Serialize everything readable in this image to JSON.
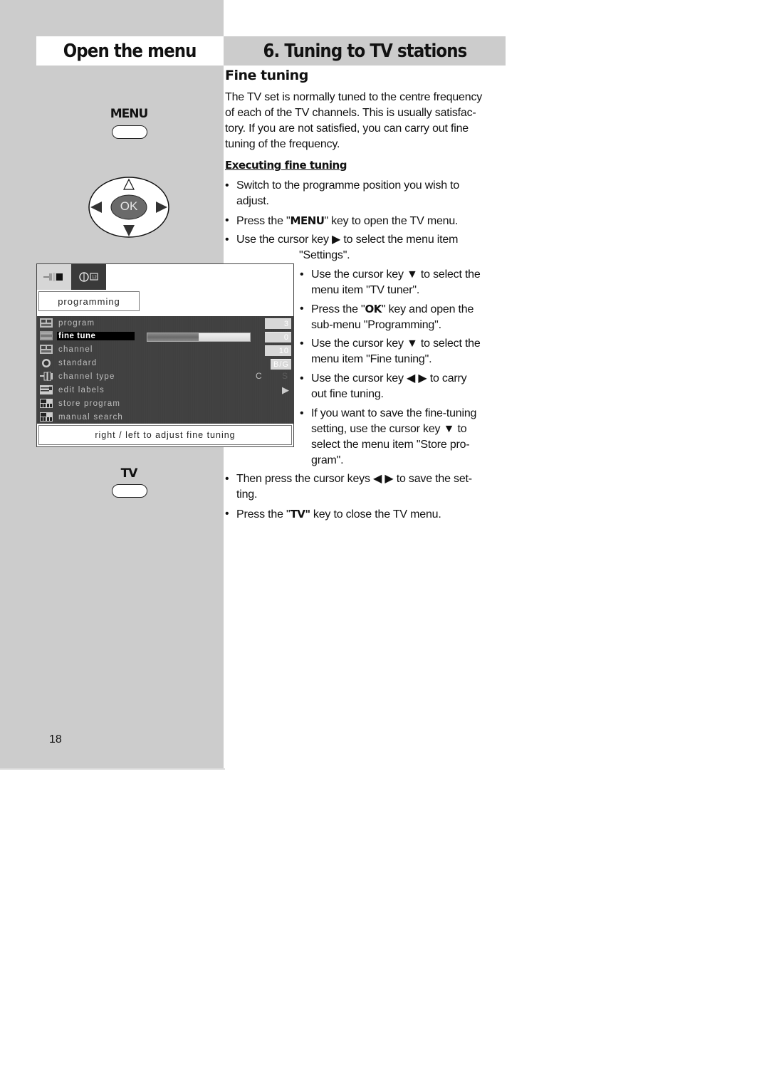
{
  "header": {
    "left_title": "Open the menu",
    "right_title": "6. Tuning to TV stations"
  },
  "remote": {
    "menu_key_label": "MENU",
    "ok_label": "OK",
    "tv_key_label": "TV",
    "dpad_icons": [
      "arrow-up-outline",
      "arrow-left-filled",
      "arrow-right-filled",
      "arrow-down-filled"
    ]
  },
  "osd_menu": {
    "tabs": [
      {
        "icon": "connector-icon",
        "active": true
      },
      {
        "icon": "tuner-dial-icon",
        "active": false
      }
    ],
    "title": "programming",
    "items": [
      {
        "label": "program",
        "icon": "program-grid-icon",
        "value": "3"
      },
      {
        "label": "fine tune",
        "icon": "fine-tune-icon",
        "value": "0",
        "selected": true,
        "slider_fraction": 0.5
      },
      {
        "label": "channel",
        "icon": "program-grid-icon",
        "value": "10"
      },
      {
        "label": "standard",
        "icon": "globe-icon",
        "value": "B/G"
      },
      {
        "label": "channel type",
        "icon": "connector-icon",
        "options": [
          "C",
          "S"
        ]
      },
      {
        "label": "edit labels",
        "icon": "edit-labels-icon",
        "value": "▶"
      },
      {
        "label": "store program",
        "icon": "store-program-icon"
      },
      {
        "label": "manual search",
        "icon": "manual-search-icon"
      }
    ],
    "footer_hint": "right /  left to adjust fine tuning"
  },
  "content": {
    "section_title": "Fine tuning",
    "intro_lines": [
      "The TV set is normally tuned to the centre frequency",
      "of each of the TV channels. This is usually satisfac-",
      "tory. If you are not satisfied, you can carry out fine",
      "tuning of the frequency."
    ],
    "subheading": "Executing fine tuning",
    "steps": [
      {
        "lines": [
          "Switch to the programme position you wish to",
          "adjust."
        ]
      },
      {
        "pre": "Press the \"",
        "key": "MENU",
        "post": "\" key to open the TV menu."
      },
      {
        "lines": [
          "Use the cursor key ▶ to select the menu item",
          "\"Settings\"."
        ]
      },
      {
        "lines": [
          "Use the cursor key ▼ to select the",
          "menu item \"TV tuner\"."
        ]
      },
      {
        "pre": "Press the \"",
        "key": "OK",
        "post": "\" key and open the",
        "line2": "sub-menu \"Programming\"."
      },
      {
        "lines": [
          "Use the cursor key ▼ to select the",
          "menu item \"Fine tuning\"."
        ]
      },
      {
        "lines": [
          "Use the cursor key ◀ ▶ to carry",
          "out fine tuning."
        ]
      },
      {
        "lines": [
          "If you want to save the fine-tuning",
          "setting, use the cursor key ▼ to",
          "select the menu item \"Store pro-",
          "gram\"."
        ]
      },
      {
        "lines": [
          "Then press the cursor keys ◀ ▶ to save the set-",
          "ting."
        ]
      },
      {
        "pre": "Press the \"",
        "key": "TV\"",
        "post": " key to close the TV menu."
      }
    ]
  },
  "footer": {
    "page_number": "18"
  }
}
